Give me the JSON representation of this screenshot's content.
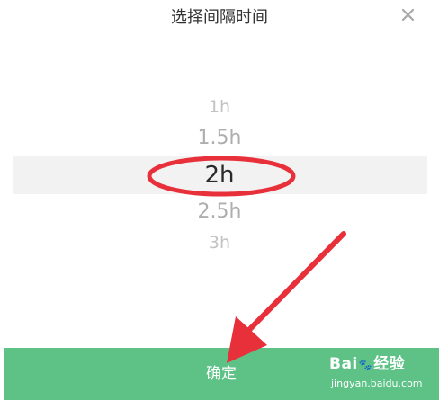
{
  "dialog": {
    "title": "选择间隔时间",
    "close_icon": "close-icon",
    "confirm_label": "确定"
  },
  "picker": {
    "options": [
      "1h",
      "1.5h",
      "2h",
      "2.5h",
      "3h"
    ],
    "selected": "2h"
  },
  "watermark": {
    "brand": "Bai",
    "brand_end": "经验",
    "paw_icon": "baidu-paw-icon",
    "url": "jingyan.baidu.com"
  },
  "colors": {
    "confirm_bg": "#5ec287",
    "annotation_red": "#e8303a",
    "selection_band": "#f2f2f2"
  }
}
